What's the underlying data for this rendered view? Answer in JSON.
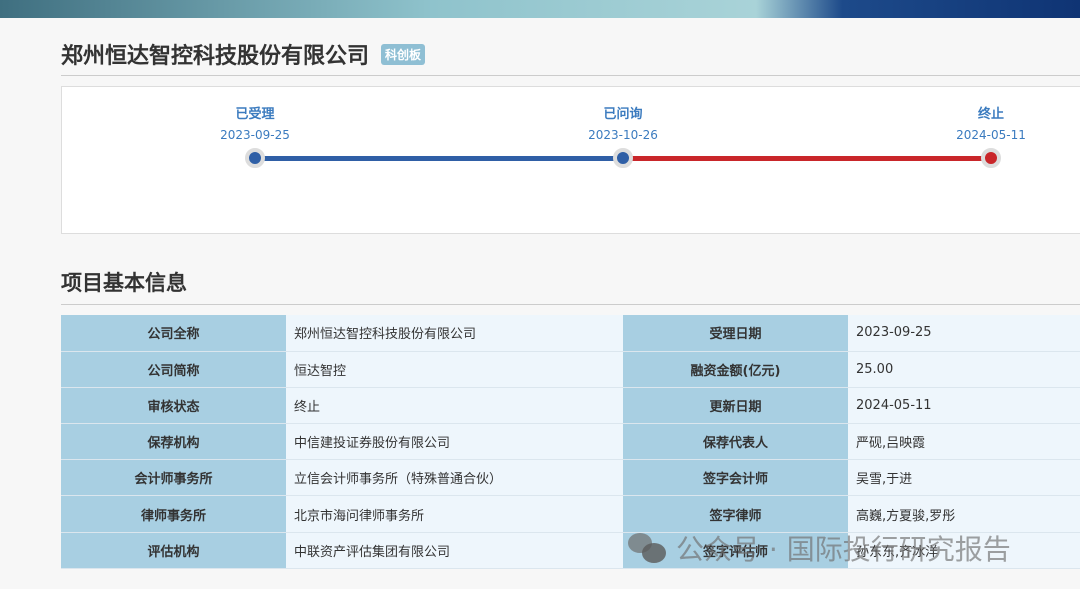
{
  "company": {
    "name": "郑州恒达智控科技股份有限公司",
    "board": "科创板"
  },
  "timeline": [
    {
      "label": "已受理",
      "date": "2023-09-25"
    },
    {
      "label": "已问询",
      "date": "2023-10-26"
    },
    {
      "label": "终止",
      "date": "2024-05-11"
    }
  ],
  "colors": {
    "blue": "#2f5fa6",
    "red": "#c9262a"
  },
  "section_title": "项目基本信息",
  "rows": [
    [
      "公司全称",
      "郑州恒达智控科技股份有限公司",
      "受理日期",
      "2023-09-25"
    ],
    [
      "公司简称",
      "恒达智控",
      "融资金额(亿元)",
      "25.00"
    ],
    [
      "审核状态",
      "终止",
      "更新日期",
      "2024-05-11"
    ],
    [
      "保荐机构",
      "中信建投证券股份有限公司",
      "保荐代表人",
      "严砚,吕映霞"
    ],
    [
      "会计师事务所",
      "立信会计师事务所（特殊普通合伙）",
      "签字会计师",
      "吴雪,于进"
    ],
    [
      "律师事务所",
      "北京市海问律师事务所",
      "签字律师",
      "高巍,方夏骏,罗彤"
    ],
    [
      "评估机构",
      "中联资产评估集团有限公司",
      "签字评估师",
      "孙东东,齐冰洋"
    ]
  ],
  "watermark": "公众号 · 国际投行研究报告"
}
